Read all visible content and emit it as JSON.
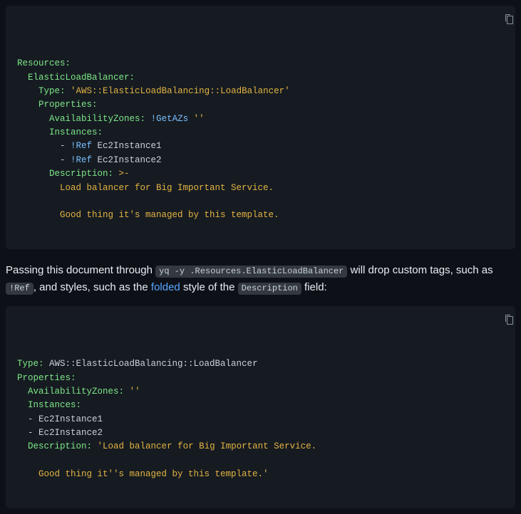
{
  "code1": {
    "lines": [
      [
        [
          "key",
          "Resources:"
        ]
      ],
      [
        [
          "plain",
          "  "
        ],
        [
          "key",
          "ElasticLoadBalancer:"
        ]
      ],
      [
        [
          "plain",
          "    "
        ],
        [
          "key",
          "Type:"
        ],
        [
          "plain",
          " "
        ],
        [
          "str",
          "'AWS::ElasticLoadBalancing::LoadBalancer'"
        ]
      ],
      [
        [
          "plain",
          "    "
        ],
        [
          "key",
          "Properties:"
        ]
      ],
      [
        [
          "plain",
          "      "
        ],
        [
          "key",
          "AvailabilityZones:"
        ],
        [
          "plain",
          " "
        ],
        [
          "tag",
          "!GetAZs"
        ],
        [
          "plain",
          " "
        ],
        [
          "str",
          "''"
        ]
      ],
      [
        [
          "plain",
          "      "
        ],
        [
          "key",
          "Instances:"
        ]
      ],
      [
        [
          "plain",
          "        - "
        ],
        [
          "tag",
          "!Ref"
        ],
        [
          "plain",
          " Ec2Instance1"
        ]
      ],
      [
        [
          "plain",
          "        - "
        ],
        [
          "tag",
          "!Ref"
        ],
        [
          "plain",
          " Ec2Instance2"
        ]
      ],
      [
        [
          "plain",
          "      "
        ],
        [
          "key",
          "Description:"
        ],
        [
          "plain",
          " "
        ],
        [
          "str",
          ">-"
        ]
      ],
      [
        [
          "str",
          "        Load balancer for Big Important Service."
        ]
      ],
      [
        [
          "plain",
          ""
        ]
      ],
      [
        [
          "str",
          "        Good thing it's managed by this template."
        ]
      ]
    ]
  },
  "paragraph": {
    "t1": "Passing this document through ",
    "cmd1": "yq -y .Resources.ElasticLoadBalancer",
    "t2": " will drop custom tags, such as ",
    "cmd2": "!Ref",
    "t3": ", and styles, such as the ",
    "link_text": "folded",
    "t4": " style of the ",
    "cmd3": "Description",
    "t5": " field:"
  },
  "code2": {
    "lines": [
      [
        [
          "key",
          "Type:"
        ],
        [
          "plain",
          " AWS::ElasticLoadBalancing::LoadBalancer"
        ]
      ],
      [
        [
          "key",
          "Properties:"
        ]
      ],
      [
        [
          "plain",
          "  "
        ],
        [
          "key",
          "AvailabilityZones:"
        ],
        [
          "plain",
          " "
        ],
        [
          "str",
          "''"
        ]
      ],
      [
        [
          "plain",
          "  "
        ],
        [
          "key",
          "Instances:"
        ]
      ],
      [
        [
          "plain",
          "  - Ec2Instance1"
        ]
      ],
      [
        [
          "plain",
          "  - Ec2Instance2"
        ]
      ],
      [
        [
          "plain",
          "  "
        ],
        [
          "key",
          "Description:"
        ],
        [
          "plain",
          " "
        ],
        [
          "str",
          "'Load balancer for Big Important Service."
        ]
      ],
      [
        [
          "plain",
          ""
        ]
      ],
      [
        [
          "str",
          "    Good thing it''s managed by this template.'"
        ]
      ]
    ]
  }
}
